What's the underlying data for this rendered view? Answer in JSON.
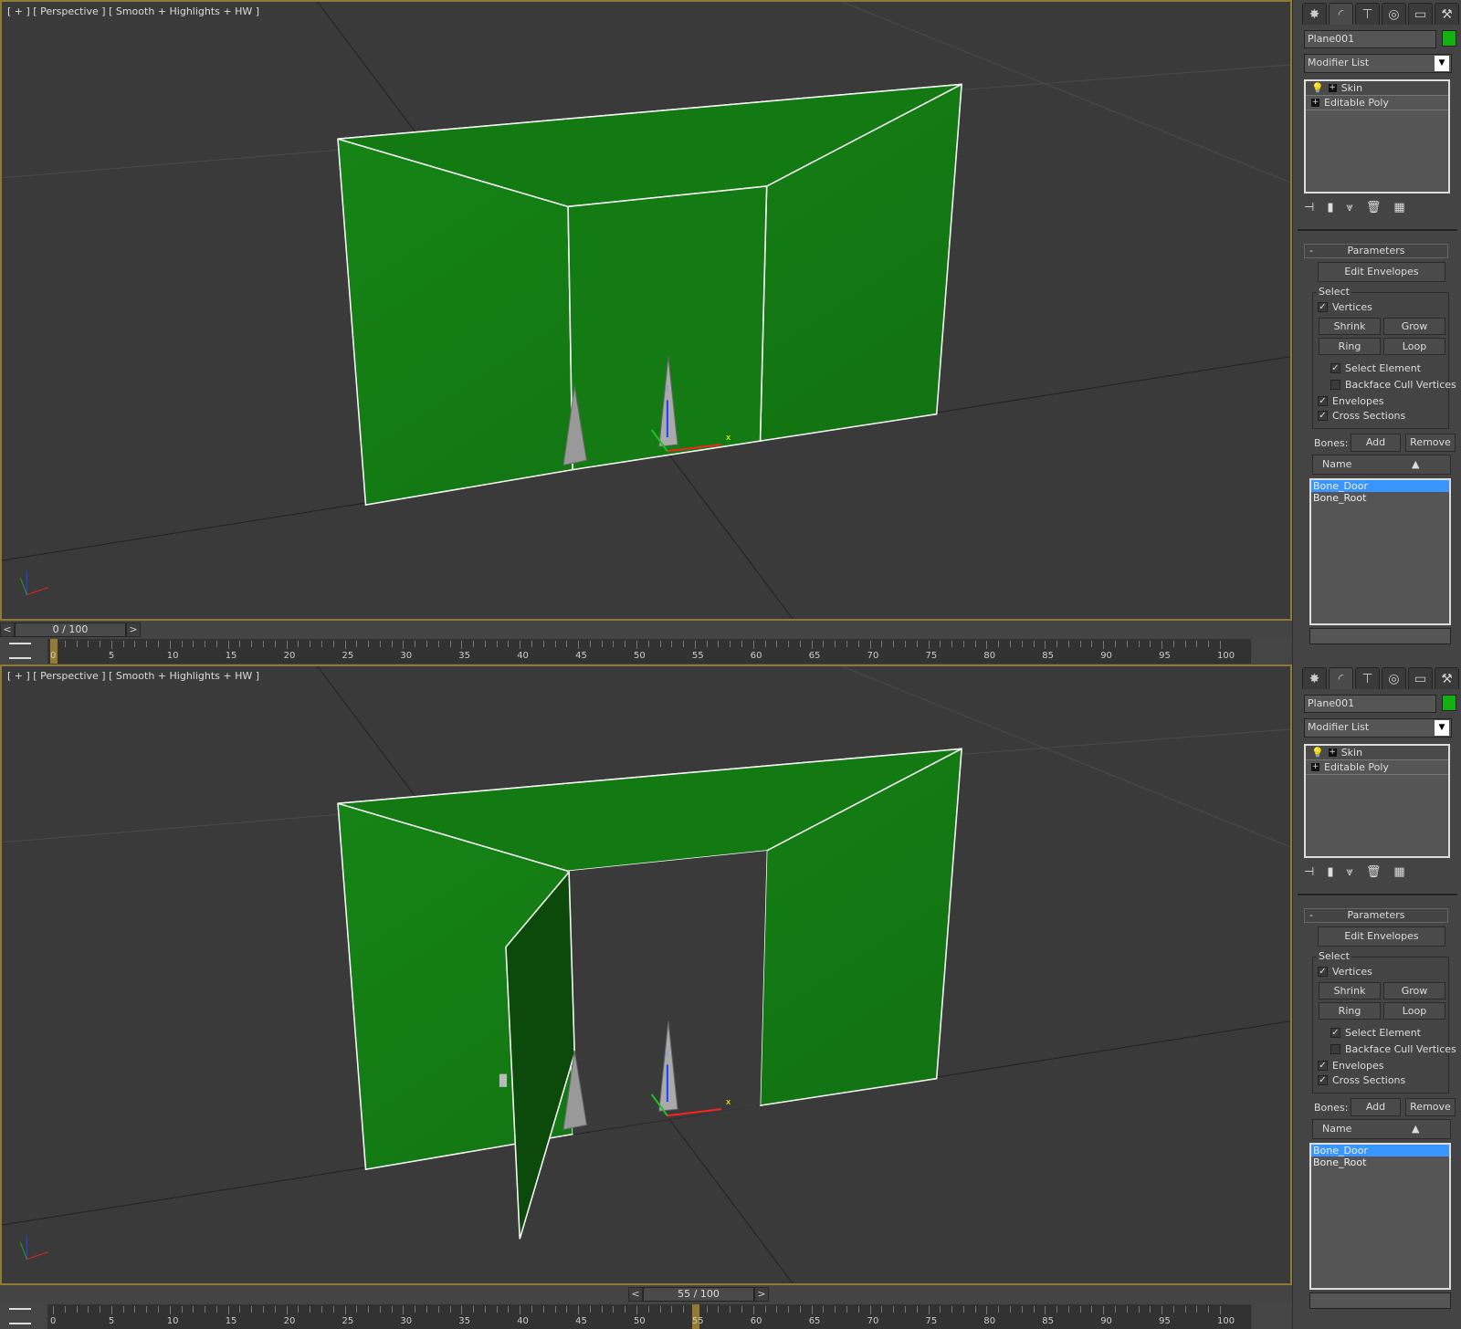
{
  "viewports": [
    {
      "label": "[ + ] [ Perspective ] [ Smooth + Highlights + HW ]",
      "door_state": "closed",
      "slider": "0 / 100",
      "current_frame": 0
    },
    {
      "label": "[ + ] [ Perspective ] [ Smooth + Highlights + HW ]",
      "door_state": "open",
      "slider": "55 / 100",
      "current_frame": 55
    }
  ],
  "timeline": {
    "start": 0,
    "end": 100,
    "labels": [
      "0",
      "5",
      "10",
      "15",
      "20",
      "25",
      "30",
      "35",
      "40",
      "45",
      "50",
      "55",
      "60",
      "65",
      "70",
      "75",
      "80",
      "85",
      "90",
      "95",
      "100"
    ],
    "prev": "<",
    "next": ">"
  },
  "axes": {
    "x": "x",
    "y": "y",
    "z": "z"
  },
  "colors": {
    "object": "#147a14",
    "door_open": "#0b4a0b",
    "selection": "#3a96ff",
    "viewport_border": "#8c7a36",
    "object_swatch": "#12b012"
  },
  "panel": {
    "tabs": [
      "create-icon",
      "modify-icon",
      "hierarchy-icon",
      "motion-icon",
      "display-icon",
      "utilities-icon"
    ],
    "object_name": "Plane001",
    "modifier_list": "Modifier List",
    "stack": [
      "Skin",
      "Editable Poly"
    ],
    "rollout": "Parameters",
    "rollout_toggle": "-",
    "edit_envelopes": "Edit Envelopes",
    "select_group": "Select",
    "vertices": "Vertices",
    "shrink": "Shrink",
    "grow": "Grow",
    "ring": "Ring",
    "loop": "Loop",
    "select_element": "Select Element",
    "backface": "Backface Cull Vertices",
    "envelopes": "Envelopes",
    "cross_sections": "Cross Sections",
    "checks": {
      "vertices": true,
      "select_element": true,
      "backface": false,
      "envelopes": true,
      "cross_sections": true
    },
    "bones_label": "Bones:",
    "add": "Add",
    "remove": "Remove",
    "name_header": "Name",
    "bones": [
      "Bone_Door",
      "Bone_Root"
    ],
    "selected_bone": "Bone_Door"
  }
}
